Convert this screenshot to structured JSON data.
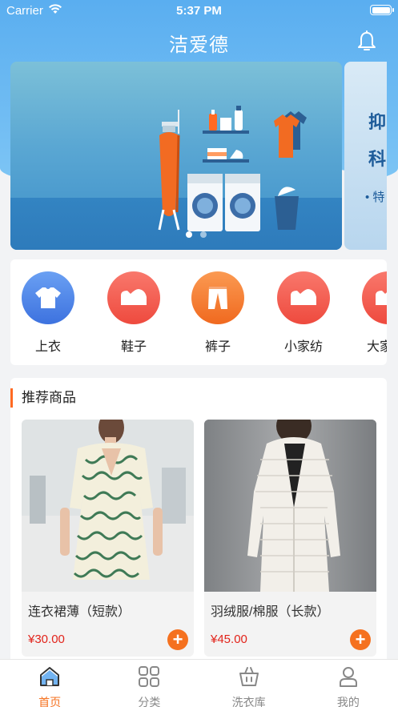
{
  "status_bar": {
    "carrier": "Carrier",
    "time": "5:37 PM"
  },
  "header": {
    "title": "洁爱德",
    "bell_icon": "bell-icon"
  },
  "banner": {
    "next_slide_text": [
      "抑",
      "科",
      "• 特"
    ],
    "dots": 2,
    "active_dot": 1
  },
  "categories": [
    {
      "label": "上衣",
      "icon": "shirt-icon",
      "color": "#4f86e8"
    },
    {
      "label": "鞋子",
      "icon": "shoe-icon",
      "color": "#f2564a"
    },
    {
      "label": "裤子",
      "icon": "pants-icon",
      "color": "#f57a2e"
    },
    {
      "label": "小家纺",
      "icon": "shoe-icon",
      "color": "#f2564a"
    },
    {
      "label": "大家",
      "icon": "shoe-icon",
      "color": "#f2564a"
    }
  ],
  "recommend": {
    "title": "推荐商品",
    "products": [
      {
        "name": "连衣裙薄（短款）",
        "price": "¥30.00"
      },
      {
        "name": "羽绒服/棉服（长款）",
        "price": "¥45.00"
      }
    ]
  },
  "tabbar": {
    "items": [
      {
        "label": "首页",
        "icon": "home-icon",
        "active": true
      },
      {
        "label": "分类",
        "icon": "grid-icon",
        "active": false
      },
      {
        "label": "洗衣库",
        "icon": "basket-icon",
        "active": false
      },
      {
        "label": "我的",
        "icon": "user-icon",
        "active": false
      }
    ]
  },
  "colors": {
    "accent": "#f5711f",
    "header_blue": "#5aaef0",
    "price_red": "#e2231a"
  }
}
